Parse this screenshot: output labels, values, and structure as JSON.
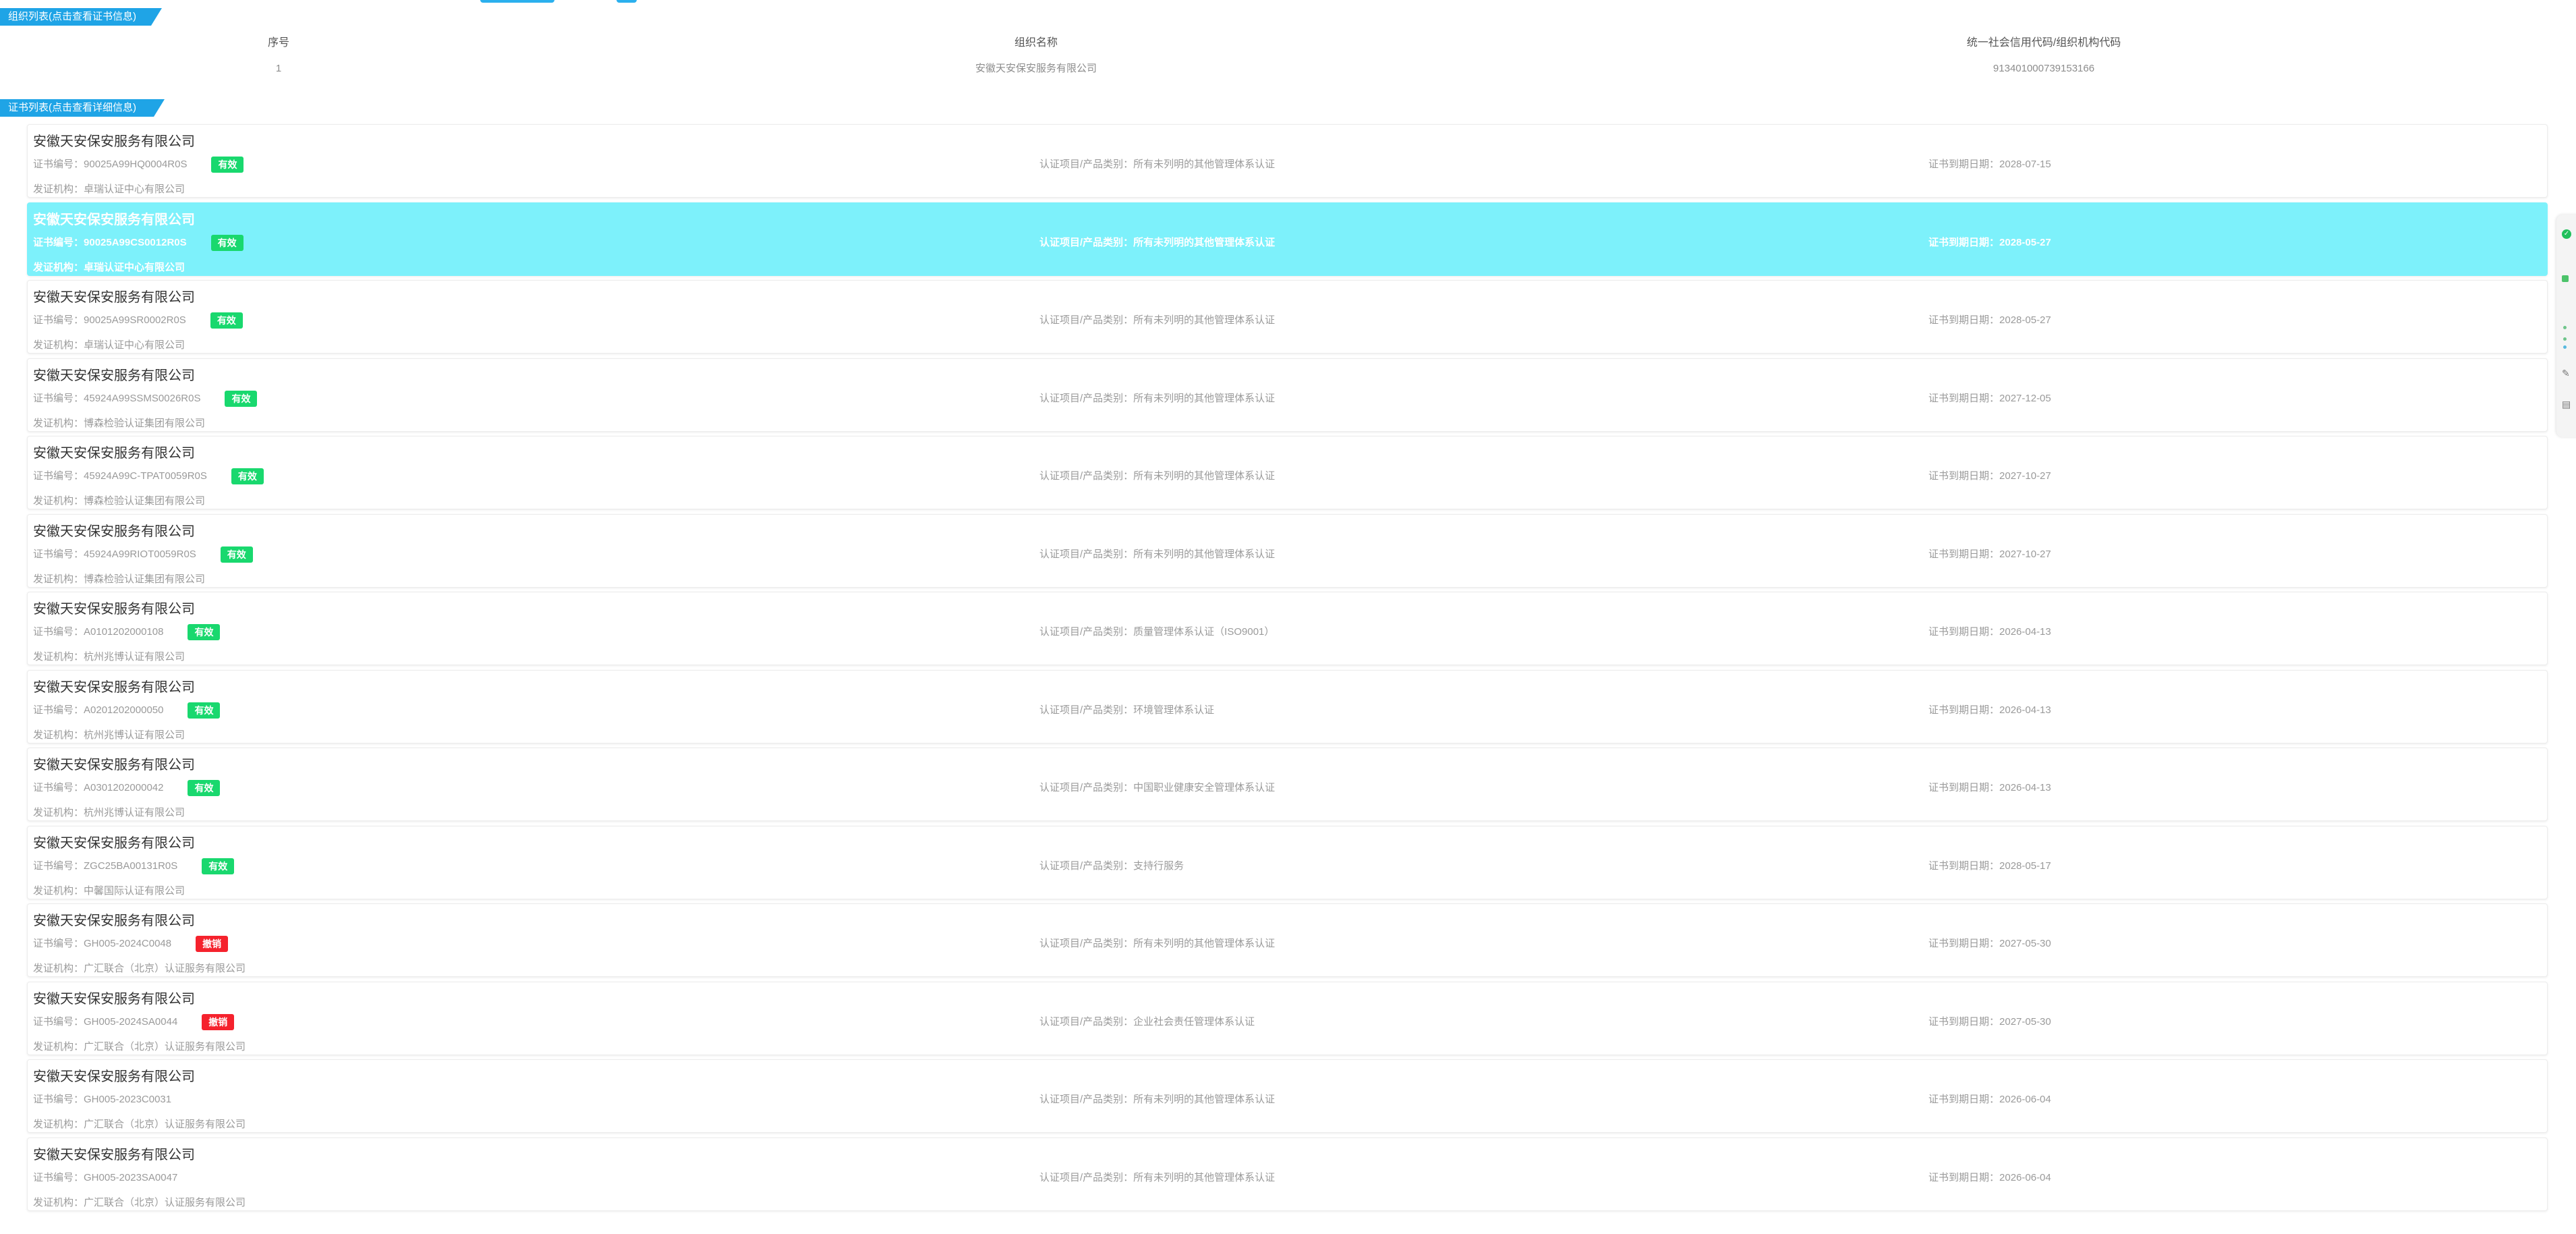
{
  "org_section": {
    "tab_label": "组织列表(点击查看证书信息)",
    "headers": [
      "序号",
      "组织名称",
      "统一社会信用代码/组织机构代码"
    ],
    "rows": [
      [
        "1",
        "安徽天安保安服务有限公司",
        "913401000739153166"
      ]
    ]
  },
  "cert_section": {
    "tab_label": "证书列表(点击查看详细信息)",
    "labels": {
      "cert_no": "证书编号：",
      "issuer": "发证机构：",
      "project": "认证项目/产品类别：",
      "expiry": "证书到期日期："
    },
    "items": [
      {
        "company": "安徽天安保安服务有限公司",
        "cert_no": "90025A99HQ0004R0S",
        "status": "有效",
        "status_type": "valid",
        "issuer": "卓瑞认证中心有限公司",
        "project": "所有未列明的其他管理体系认证",
        "expiry": "2028-07-15"
      },
      {
        "company": "安徽天安保安服务有限公司",
        "cert_no": "90025A99CS0012R0S",
        "status": "有效",
        "status_type": "valid",
        "issuer": "卓瑞认证中心有限公司",
        "project": "所有未列明的其他管理体系认证",
        "expiry": "2028-05-27",
        "selected": true
      },
      {
        "company": "安徽天安保安服务有限公司",
        "cert_no": "90025A99SR0002R0S",
        "status": "有效",
        "status_type": "valid",
        "issuer": "卓瑞认证中心有限公司",
        "project": "所有未列明的其他管理体系认证",
        "expiry": "2028-05-27"
      },
      {
        "company": "安徽天安保安服务有限公司",
        "cert_no": "45924A99SSMS0026R0S",
        "status": "有效",
        "status_type": "valid",
        "issuer": "博森检验认证集团有限公司",
        "project": "所有未列明的其他管理体系认证",
        "expiry": "2027-12-05"
      },
      {
        "company": "安徽天安保安服务有限公司",
        "cert_no": "45924A99C-TPAT0059R0S",
        "status": "有效",
        "status_type": "valid",
        "issuer": "博森检验认证集团有限公司",
        "project": "所有未列明的其他管理体系认证",
        "expiry": "2027-10-27"
      },
      {
        "company": "安徽天安保安服务有限公司",
        "cert_no": "45924A99RIOT0059R0S",
        "status": "有效",
        "status_type": "valid",
        "issuer": "博森检验认证集团有限公司",
        "project": "所有未列明的其他管理体系认证",
        "expiry": "2027-10-27"
      },
      {
        "company": "安徽天安保安服务有限公司",
        "cert_no": "A0101202000108",
        "status": "有效",
        "status_type": "valid",
        "issuer": "杭州兆博认证有限公司",
        "project": "质量管理体系认证（ISO9001）",
        "expiry": "2026-04-13"
      },
      {
        "company": "安徽天安保安服务有限公司",
        "cert_no": "A0201202000050",
        "status": "有效",
        "status_type": "valid",
        "issuer": "杭州兆博认证有限公司",
        "project": "环境管理体系认证",
        "expiry": "2026-04-13"
      },
      {
        "company": "安徽天安保安服务有限公司",
        "cert_no": "A0301202000042",
        "status": "有效",
        "status_type": "valid",
        "issuer": "杭州兆博认证有限公司",
        "project": "中国职业健康安全管理体系认证",
        "expiry": "2026-04-13"
      },
      {
        "company": "安徽天安保安服务有限公司",
        "cert_no": "ZGC25BA00131R0S",
        "status": "有效",
        "status_type": "valid",
        "issuer": "中馨国际认证有限公司",
        "project": "支持行服务",
        "expiry": "2028-05-17"
      },
      {
        "company": "安徽天安保安服务有限公司",
        "cert_no": "GH005-2024C0048",
        "status": "撤销",
        "status_type": "revoked",
        "issuer": "广汇联合（北京）认证服务有限公司",
        "project": "所有未列明的其他管理体系认证",
        "expiry": "2027-05-30"
      },
      {
        "company": "安徽天安保安服务有限公司",
        "cert_no": "GH005-2024SA0044",
        "status": "撤销",
        "status_type": "revoked",
        "issuer": "广汇联合（北京）认证服务有限公司",
        "project": "企业社会责任管理体系认证",
        "expiry": "2027-05-30"
      },
      {
        "company": "安徽天安保安服务有限公司",
        "cert_no": "GH005-2023C0031",
        "status": "",
        "status_type": "",
        "issuer": "广汇联合（北京）认证服务有限公司",
        "project": "所有未列明的其他管理体系认证",
        "expiry": "2026-06-04"
      },
      {
        "company": "安徽天安保安服务有限公司",
        "cert_no": "GH005-2023SA0047",
        "status": "",
        "status_type": "",
        "issuer": "广汇联合（北京）认证服务有限公司",
        "project": "所有未列明的其他管理体系认证",
        "expiry": "2026-06-04"
      }
    ]
  },
  "float_toolbar": {
    "icons": [
      "check-circle-icon",
      "green-square-icon",
      "status-dots-icon",
      "edit-icon",
      "document-icon"
    ]
  },
  "colors": {
    "tab_blue": "#1fa4e6",
    "selected_row": "#7df1fb",
    "badge_valid": "#19d86e",
    "badge_revoked": "#f5222d"
  }
}
